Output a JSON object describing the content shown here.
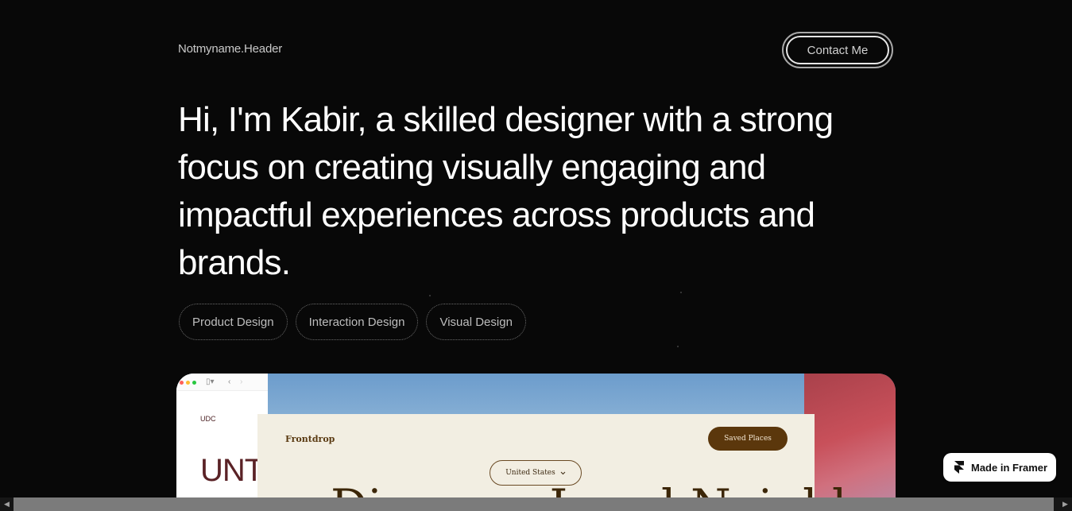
{
  "header": {
    "brand": "Notmyname.Header",
    "contact_label": "Contact Me"
  },
  "hero": {
    "text": "Hi, I'm Kabir, a skilled designer with a strong focus on creating visually engaging and impactful experiences across products and brands."
  },
  "tags": [
    "Product Design",
    "Interaction Design",
    "Visual Design"
  ],
  "preview": {
    "left_panel": {
      "label": "UDC",
      "heading": "UNT"
    },
    "inner_page": {
      "logo": "Frontdrop",
      "saved_button": "Saved Places",
      "country_select": "United States",
      "big_heading": "Discover Local Neighbourhoods"
    }
  },
  "badge": {
    "label": "Made in Framer"
  },
  "colors": {
    "background": "#080808",
    "saved_button": "#5b370c",
    "inner_page": "#f2eee2"
  },
  "icons": [
    "framer-logo-icon",
    "chevron-down-icon",
    "scroll-left-arrow-icon",
    "scroll-right-arrow-icon"
  ]
}
